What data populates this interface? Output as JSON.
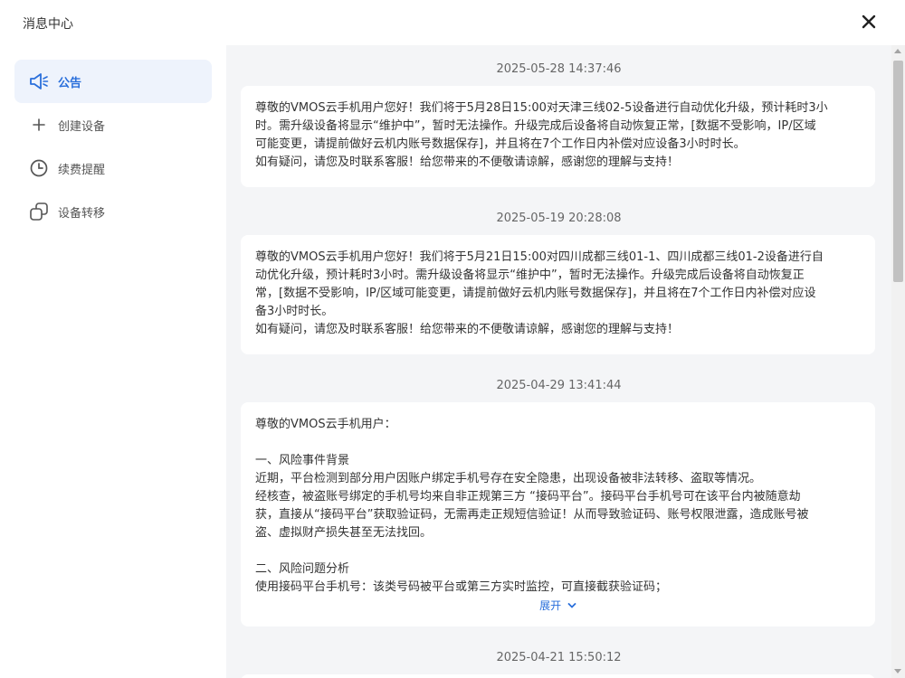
{
  "header": {
    "title": "消息中心"
  },
  "sidebar": {
    "items": [
      {
        "label": "公告",
        "icon": "megaphone-icon",
        "active": true
      },
      {
        "label": "创建设备",
        "icon": "plus-icon",
        "active": false
      },
      {
        "label": "续费提醒",
        "icon": "clock-icon",
        "active": false
      },
      {
        "label": "设备转移",
        "icon": "transfer-icon",
        "active": false
      }
    ]
  },
  "messages": [
    {
      "time": "2025-05-28 14:37:46",
      "body": "尊敬的VMOS云手机用户您好！我们将于5月28日15:00对天津三线02-5设备进行自动优化升级，预计耗时3小\n时。需升级设备将显示“维护中”，暂时无法操作。升级完成后设备将自动恢复正常，[数据不受影响，IP/区域\n可能变更，请提前做好云机内账号数据保存]，并且将在7个工作日内补偿对应设备3小时时长。\n如有疑问，请您及时联系客服！给您带来的不便敬请谅解，感谢您的理解与支持！"
    },
    {
      "time": "2025-05-19 20:28:08",
      "body": "尊敬的VMOS云手机用户您好！我们将于5月21日15:00对四川成都三线01-1、四川成都三线01-2设备进行自\n动优化升级，预计耗时3小时。需升级设备将显示“维护中”，暂时无法操作。升级完成后设备将自动恢复正\n常，[数据不受影响，IP/区域可能变更，请提前做好云机内账号数据保存]，并且将在7个工作日内补偿对应设\n备3小时时长。\n如有疑问，请您及时联系客服！给您带来的不便敬请谅解，感谢您的理解与支持！"
    },
    {
      "time": "2025-04-29 13:41:44",
      "body": "尊敬的VMOS云手机用户：\n\n一、风险事件背景\n近期，平台检测到部分用户因账户绑定手机号存在安全隐患，出现设备被非法转移、盗取等情况。\n经核查，被盗账号绑定的手机号均来自非正规第三方 “接码平台”。接码平台手机号可在该平台内被随意劫\n获，直接从“接码平台”获取验证码，无需再走正规短信验证！从而导致验证码、账号权限泄露，造成账号被\n盗、虚拟财产损失甚至无法找回。\n\n二、风险问题分析\n使用接码平台手机号：该类号码被平台或第三方实时监控，可直接截获验证码；",
      "expand_label": "展开"
    },
    {
      "time": "2025-04-21 15:50:12"
    }
  ]
}
